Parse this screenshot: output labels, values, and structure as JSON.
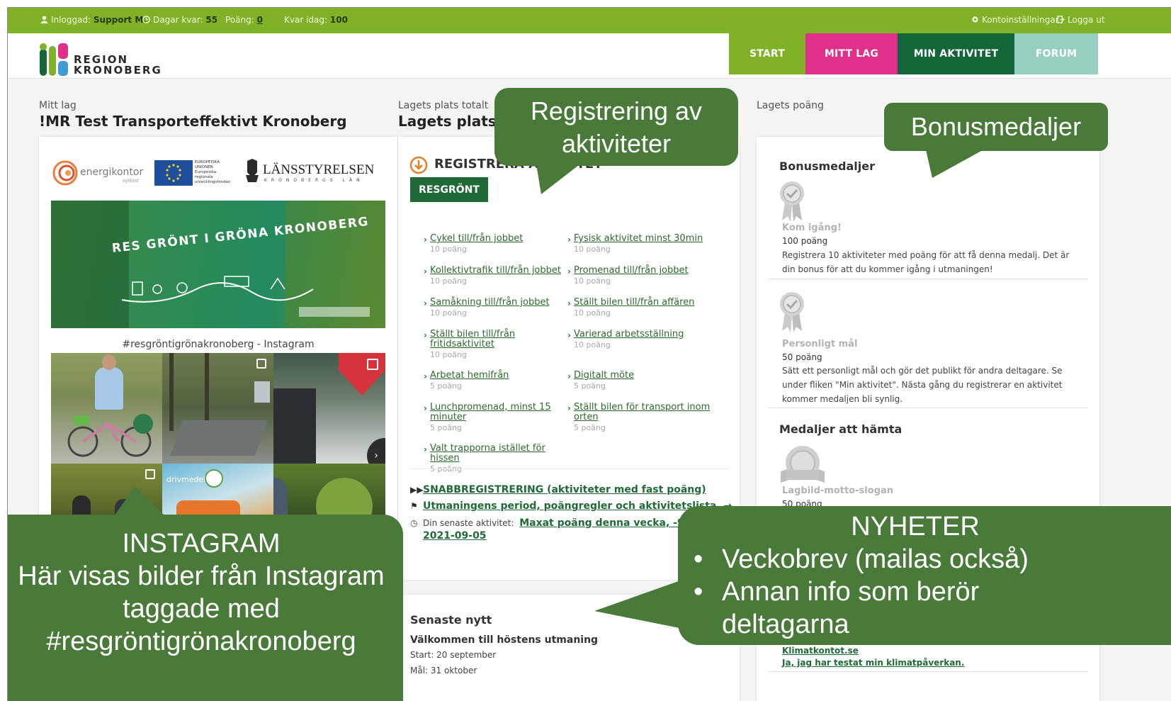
{
  "topbar": {
    "logged_in_label": "Inloggad:",
    "logged_in_user": "Support M.",
    "days_left_label": "Dagar kvar:",
    "days_left_value": "55",
    "points_label": "Poäng:",
    "points_value": "0",
    "left_today_label": "Kvar idag:",
    "left_today_value": "100",
    "account_settings": "Kontoinställningar",
    "logout": "Logga ut"
  },
  "header": {
    "logo_line1": "REGION",
    "logo_line2": "KRONOBERG",
    "nav": [
      {
        "label": "START",
        "color": "#7fb227"
      },
      {
        "label": "MITT LAG",
        "color": "#e0308a"
      },
      {
        "label": "MIN AKTIVITET",
        "color": "#12663a"
      },
      {
        "label": "FORUM",
        "color": "#96cfc2"
      }
    ]
  },
  "left": {
    "label": "Mitt lag",
    "title": "!MR Test Transporteffektivt Kronoberg",
    "sponsors": {
      "energikontor": "energikontor",
      "energikontor_sub": "sydost",
      "eu_text": "EUROPEISKA UNIONEN Europeiska regionala utvecklingsfonden",
      "lst": "LÄNSSTYRELSEN",
      "lst_sub": "KRONOBERGS LÄN"
    },
    "banner_text": "RES GRÖNT I GRÖNA KRONOBERG",
    "instagram_caption": "#resgröntigrönakronoberg - Instagram",
    "poster_text": "drivmedel"
  },
  "middle": {
    "label": "Lagets plats totalt",
    "title": "Lagets plats totalt",
    "section_title": "REGISTRERA AKTIVITET",
    "category_button": "RESGRÖNT",
    "activities_left": [
      {
        "name": "Cykel till/från jobbet",
        "points": "10 poäng"
      },
      {
        "name": "Kollektivtrafik till/från jobbet",
        "points": "10 poäng"
      },
      {
        "name": "Samåkning till/från jobbet",
        "points": "10 poäng"
      },
      {
        "name": "Ställt bilen till/från fritidsaktivitet",
        "points": "10 poäng"
      },
      {
        "name": "Arbetat hemifrån",
        "points": "5 poäng"
      },
      {
        "name": "Lunchpromenad, minst 15 minuter",
        "points": "5 poäng"
      },
      {
        "name": "Valt trapporna istället för hissen",
        "points": "5 poäng"
      }
    ],
    "activities_right": [
      {
        "name": "Fysisk aktivitet minst 30min",
        "points": "10 poäng"
      },
      {
        "name": "Promenad till/från jobbet",
        "points": "10 poäng"
      },
      {
        "name": "Ställt bilen till/från affären",
        "points": "10 poäng"
      },
      {
        "name": "Varierad arbetsställning",
        "points": "10 poäng"
      },
      {
        "name": "Digitalt möte",
        "points": "5 poäng"
      },
      {
        "name": "Ställt bilen för transport inom orten",
        "points": "5 poäng"
      }
    ],
    "quick_registration": "SNABBREGISTRERING (aktiviteter med fast poäng)",
    "rules_link": "Utmaningens period, poängregler och aktivitetslista. →",
    "latest_label": "Din senaste aktivitet:",
    "latest_value": "Maxat poäng denna vecka, -9000 p",
    "latest_date": "2021-09-05",
    "news": {
      "title": "Senaste nytt",
      "headline": "Välkommen till höstens utmaning",
      "start": "Start: 20 september",
      "end": "Mål: 31 oktober"
    }
  },
  "right": {
    "label": "Lagets poäng",
    "bonus_title": "Bonusmedaljer",
    "medals": [
      {
        "name": "Kom igång!",
        "points": "100 poäng",
        "desc": "Registrera 10 aktiviteter med poäng för att få denna medalj. Det är din bonus för att du kommer igång i utmaningen!"
      },
      {
        "name": "Personligt mål",
        "points": "50 poäng",
        "desc": "Sätt ett personligt mål och gör det publikt för andra deltagare. Se under fliken \"Min aktivitet\". Nästa gång du registrerar en aktivitet kommer medaljen bli synlig."
      }
    ],
    "fetch_title": "Medaljer att hämta",
    "fetch_medal": {
      "name": "Lagbild-motto-slogan",
      "points": "50 poäng"
    },
    "link1": "Klimatkontot.se",
    "link2": "Ja, jag har testat min klimatpåverkan."
  },
  "callouts": {
    "registrering_line1": "Registrering av",
    "registrering_line2": "aktiviteter",
    "bonus": "Bonusmedaljer",
    "instagram_line1": "INSTAGRAM",
    "instagram_line2": "Här visas bilder från Instagram",
    "instagram_line3": "taggade med",
    "instagram_line4": "#resgröntigrönakronoberg",
    "nyheter_title": "NYHETER",
    "nyheter_bullet1": "Veckobrev (mailas också)",
    "nyheter_bullet2_line1": "Annan info som berör",
    "nyheter_bullet2_line2": "deltagarna"
  }
}
